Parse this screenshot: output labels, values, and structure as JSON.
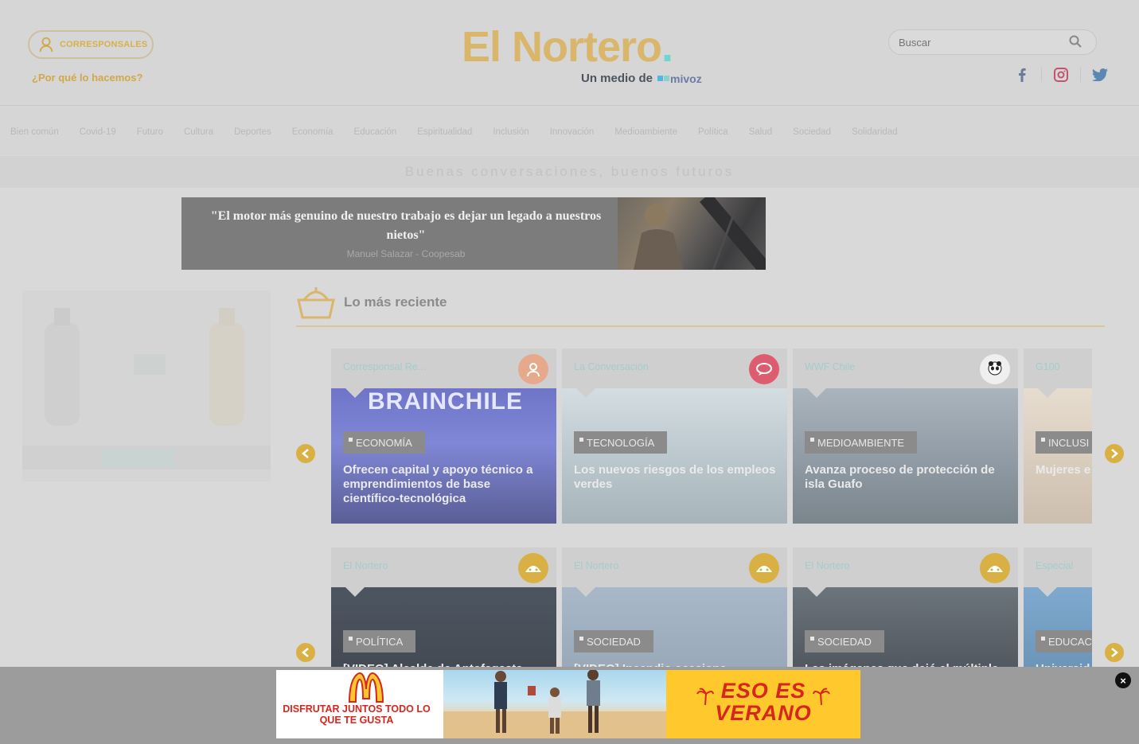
{
  "header": {
    "corresponsales_label": "CORRESPONSALES",
    "why_link": "¿Por qué lo hacemos?",
    "logo_text": "El Nortero",
    "logo_dot": ".",
    "medio_de": "Un medio de",
    "mivoz": "mivoz",
    "search_placeholder": "Buscar"
  },
  "nav": [
    "Bien común",
    "Covid-19",
    "Futuro",
    "Cultura",
    "Deportes",
    "Economía",
    "Educación",
    "Espiritualidad",
    "Inclusión",
    "Innovación",
    "Medioambiente",
    "Política",
    "Salud",
    "Sociedad",
    "Solidaridad"
  ],
  "tagline": "Buenas conversaciones, buenos futuros",
  "quote_banner": {
    "quote": "\"El motor más genuino de nuestro trabajo es dejar un legado a nuestros nietos\"",
    "author": "Manuel Salazar - Coopesab"
  },
  "section": {
    "title": "Lo más reciente"
  },
  "row1": [
    {
      "source": "Corresponsal Re...",
      "category": "ECONOMÍA",
      "title": "Ofrecen capital y apoyo técnico a emprendimientos de base científico-tecnológica",
      "image_text": "BRAINCHILE"
    },
    {
      "source": "La Conversación",
      "category": "TECNOLOGÍA",
      "title": "Los nuevos riesgos de los empleos verdes"
    },
    {
      "source": "WWF Chile",
      "category": "MEDIOAMBIENTE",
      "title": "Avanza proceso de protección de isla Guafo",
      "badge": "WWF"
    },
    {
      "source": "G100",
      "category": "INCLUSI",
      "title": "Mujeres e desafíos participac"
    }
  ],
  "row2": [
    {
      "source": "El Nortero",
      "category": "POLÍTICA",
      "title": "[VIDEO] Alcalde de Antofagasta"
    },
    {
      "source": "El Nortero",
      "category": "SOCIEDAD",
      "title": "[VIDEO] Incendio ocasiona"
    },
    {
      "source": "El Nortero",
      "category": "SOCIEDAD",
      "title": "Las imágenes que dejó el múltiple protagonizado camión en Antofagasta [+ FOTOS]"
    },
    {
      "source": "Especial",
      "category": "EDUCAC",
      "title": "Universid primer Ca"
    }
  ],
  "bottom_ad": {
    "left_text": "DISFRUTAR JUNTOS TODO LO QUE TE GUSTA",
    "right_text": "ESO ES VERANO",
    "close": "×"
  },
  "colors": {
    "accent": "#d9b044",
    "teal": "#6ed6d2",
    "mc_red": "#d7261d",
    "mc_yellow": "#ffc82c"
  }
}
